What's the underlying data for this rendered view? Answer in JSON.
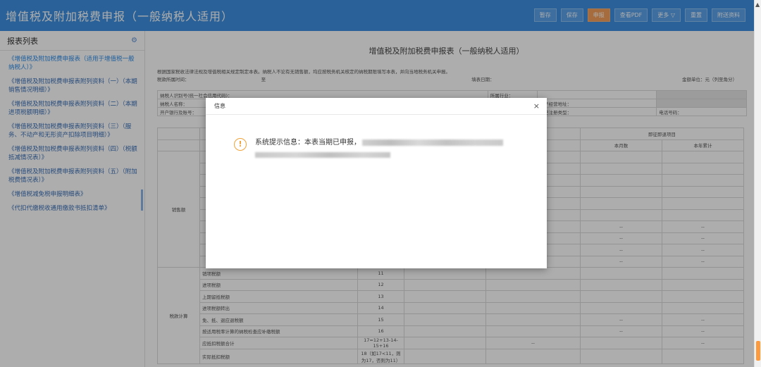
{
  "header": {
    "title": "增值税及附加税费申报（一般纳税人适用）",
    "toolbar": [
      {
        "label": "暂存"
      },
      {
        "label": "保存"
      },
      {
        "label": "申报",
        "primary": true
      },
      {
        "label": "查看PDF"
      },
      {
        "label": "更多 ▽"
      },
      {
        "label": "重置"
      },
      {
        "label": "附送资料"
      }
    ]
  },
  "sidebar": {
    "title": "报表列表",
    "items": [
      {
        "label": "《增值税及附加税费申报表（适用于增值税一般纳税人）》",
        "active": true
      },
      {
        "label": "《增值税及附加税费申报表附列资料（一）（本期销售情况明细）》"
      },
      {
        "label": "《增值税及附加税费申报表附列资料（二）（本期进项税额明细）》"
      },
      {
        "label": "《增值税及附加税费申报表附列资料（三）（服务、不动产和无形资产扣除项目明细）》"
      },
      {
        "label": "《增值税及附加税费申报表附列资料（四）（税额抵减情况表）》"
      },
      {
        "label": "《增值税及附加税费申报表附列资料（五）（附加税费情况表）》"
      },
      {
        "label": "《增值税减免税申报明细表》"
      },
      {
        "label": "《代扣代缴税收通用缴款书抵扣清单》"
      }
    ]
  },
  "form": {
    "title": "增值税及附加税费申报表（一般纳税人适用）",
    "note": "根据国家税收法律法规及增值税相关规定制定本表。纳税人不论有无销售额，均应按税务机关核定的纳税期限填写本表，并向当地税务机关申报。",
    "period_label": "税款所属时间：",
    "period_to": "至",
    "fill_date_label": "填表日期：",
    "unit_label": "金额单位：元（列至角分）",
    "info_rows": {
      "taxpayer_id": "纳税人识别号(统一社会信用代码)：",
      "industry": "所属行业：",
      "taxpayer_name": "纳税人名称：",
      "address": "生产经营地址：",
      "bank": "开户银行及账号：",
      "reg_type": "登记注册类型：",
      "phone": "电话号码："
    },
    "col_headers": {
      "immediate": "即征即退项目",
      "this_month": "本月数",
      "this_year": "本年累计"
    },
    "section_sales": "销售额",
    "section_tax": "税款计算",
    "tax_rows": [
      {
        "label": "进项税额",
        "no": "12"
      },
      {
        "label": "上期留抵税额",
        "no": "13"
      },
      {
        "label": "进项税额转出",
        "no": "14"
      },
      {
        "label": "免、抵、退应退税额",
        "no": "15"
      },
      {
        "label": "按适用税率计算的纳税检查应补缴税额",
        "no": "16"
      },
      {
        "label": "应抵扣税额合计",
        "no": "17=12+13-14-15+16"
      },
      {
        "label": "实际抵扣税额",
        "no": "18（如17<11，则为17，否则为11）"
      }
    ],
    "row11_no": "11",
    "dash": "--"
  },
  "dialog": {
    "title": "信息",
    "close": "×",
    "icon": "!",
    "message": "系统提示信息：本表当期已申报，"
  }
}
